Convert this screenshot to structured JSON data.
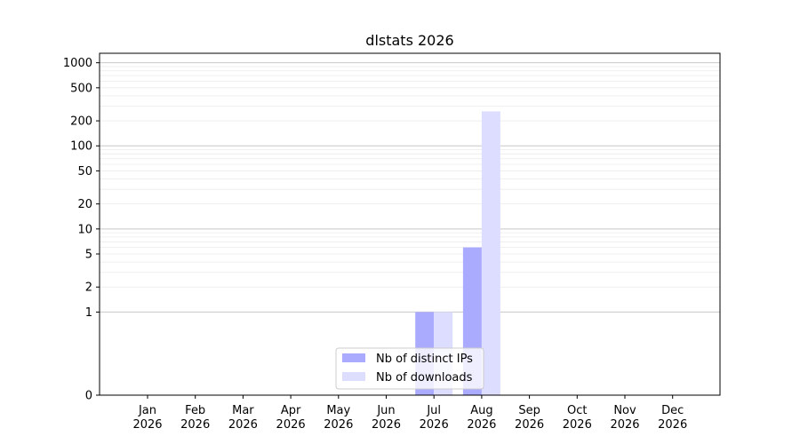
{
  "chart_data": {
    "type": "bar",
    "title": "dlstats 2026",
    "xlabel": "",
    "ylabel": "",
    "y_scale": "symlog",
    "ylim": [
      0,
      1300
    ],
    "y_ticks": [
      0,
      1,
      2,
      5,
      10,
      20,
      50,
      100,
      200,
      500,
      1000
    ],
    "y_tick_labels": [
      "0",
      "1",
      "2",
      "5",
      "10",
      "20",
      "50",
      "100",
      "200",
      "500",
      "1000"
    ],
    "grid": true,
    "legend_position": "bottom-center",
    "categories": [
      "Jan\n2026",
      "Feb\n2026",
      "Mar\n2026",
      "Apr\n2026",
      "May\n2026",
      "Jun\n2026",
      "Jul\n2026",
      "Aug\n2026",
      "Sep\n2026",
      "Oct\n2026",
      "Nov\n2026",
      "Dec\n2026"
    ],
    "category_lines": [
      [
        "Jan",
        "2026"
      ],
      [
        "Feb",
        "2026"
      ],
      [
        "Mar",
        "2026"
      ],
      [
        "Apr",
        "2026"
      ],
      [
        "May",
        "2026"
      ],
      [
        "Jun",
        "2026"
      ],
      [
        "Jul",
        "2026"
      ],
      [
        "Aug",
        "2026"
      ],
      [
        "Sep",
        "2026"
      ],
      [
        "Oct",
        "2026"
      ],
      [
        "Nov",
        "2026"
      ],
      [
        "Dec",
        "2026"
      ]
    ],
    "series": [
      {
        "name": "Nb of distinct IPs",
        "color": "#aaaaff",
        "values": [
          0,
          0,
          0,
          0,
          0,
          0,
          1,
          6,
          0,
          0,
          0,
          0
        ]
      },
      {
        "name": "Nb of downloads",
        "color": "#ddddff",
        "values": [
          0,
          0,
          0,
          0,
          0,
          0,
          1,
          260,
          0,
          0,
          0,
          0
        ]
      }
    ]
  }
}
